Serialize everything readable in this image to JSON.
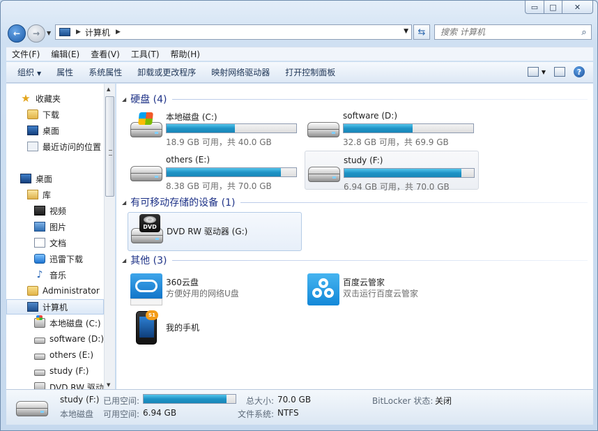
{
  "window": {
    "min": "▭",
    "max": "□",
    "close": "✕"
  },
  "address": {
    "root": "计算机"
  },
  "search": {
    "placeholder": "搜索 计算机"
  },
  "menu": [
    "文件(F)",
    "编辑(E)",
    "查看(V)",
    "工具(T)",
    "帮助(H)"
  ],
  "commands": {
    "organize": "组织",
    "items": [
      "属性",
      "系统属性",
      "卸载或更改程序",
      "映射网络驱动器",
      "打开控制面板"
    ]
  },
  "nav": {
    "favorites": "收藏夹",
    "downloads": "下载",
    "desktop_fav": "桌面",
    "recent": "最近访问的位置",
    "desktop": "桌面",
    "library": "库",
    "videos": "视频",
    "pictures": "图片",
    "documents": "文档",
    "thunder": "迅雷下载",
    "music": "音乐",
    "admin": "Administrator",
    "computer": "计算机",
    "drive_c": "本地磁盘 (C:)",
    "drive_d": "software (D:)",
    "drive_e": "others (E:)",
    "drive_f": "study (F:)",
    "drive_g": "DVD RW 驱动"
  },
  "groups": {
    "hdd": "硬盘 (4)",
    "removable": "有可移动存储的设备 (1)",
    "other": "其他 (3)"
  },
  "drives": [
    {
      "name": "本地磁盘 (C:)",
      "free": "18.9 GB 可用，共 40.0 GB",
      "used_fraction": 0.5275
    },
    {
      "name": "software (D:)",
      "free": "32.8 GB 可用，共 69.9 GB",
      "used_fraction": 0.5308
    },
    {
      "name": "others (E:)",
      "free": "8.38 GB 可用，共 70.0 GB",
      "used_fraction": 0.8803
    },
    {
      "name": "study (F:)",
      "free": "6.94 GB 可用，共 70.0 GB",
      "used_fraction": 0.9009
    }
  ],
  "dvd": {
    "name": "DVD RW 驱动器 (G:)",
    "label": "DVD"
  },
  "others": [
    {
      "name": "360云盘",
      "desc": "方便好用的网络U盘"
    },
    {
      "name": "百度云管家",
      "desc": "双击运行百度云管家"
    },
    {
      "name": "我的手机",
      "badge": "S1"
    }
  ],
  "details": {
    "name": "study (F:)",
    "type": "本地磁盘",
    "used_label": "已用空间:",
    "used_fraction": 0.9009,
    "free_label": "可用空间:",
    "free_value": "6.94 GB",
    "total_label": "总大小:",
    "total_value": "70.0 GB",
    "fs_label": "文件系统:",
    "fs_value": "NTFS",
    "bitlocker_label": "BitLocker 状态:",
    "bitlocker_value": "关闭"
  }
}
